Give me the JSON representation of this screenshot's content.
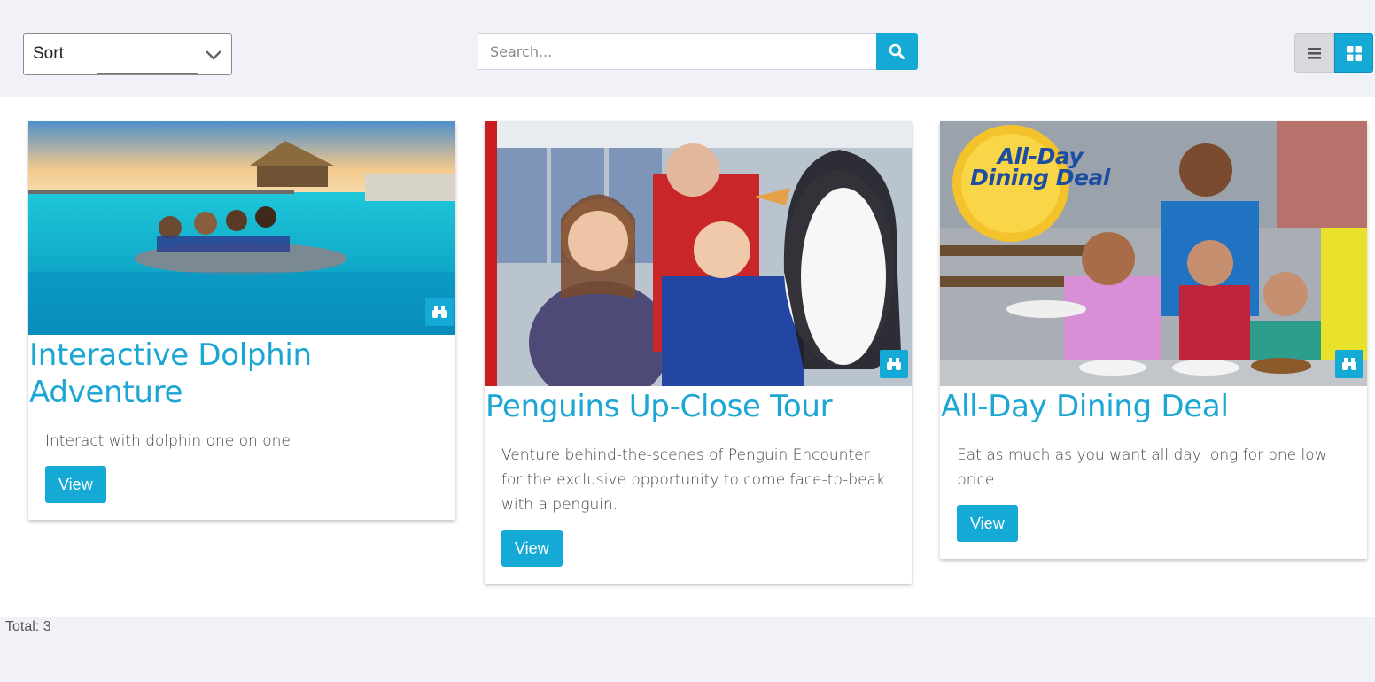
{
  "toolbar": {
    "sort_label": "Sort",
    "search_placeholder": "Search...",
    "search_value": ""
  },
  "colors": {
    "accent": "#15a9d6",
    "title": "#1ba6d3",
    "background": "#f1f2f7"
  },
  "icons": {
    "sort_chevron": "chevron-down-icon",
    "search": "search-icon",
    "list_view": "list-view-icon",
    "grid_view": "grid-view-icon",
    "details": "binoculars-icon"
  },
  "cards": [
    {
      "title": "Interactive Dolphin Adventure",
      "description": "Interact with dolphin one on one",
      "button": "View",
      "image": "dolphin swim photo"
    },
    {
      "title": "Penguins Up-Close Tour",
      "description": "Venture behind-the-scenes of Penguin Encounter for the exclusive opportunity to come face-to-beak with a penguin.",
      "button": "View",
      "image": "penguin encounter photo"
    },
    {
      "title": "All-Day Dining Deal",
      "description": "Eat as much as you want all day long for one low price.",
      "button": "View",
      "image": "family dining photo",
      "image_badge": "All-Day Dining Deal"
    }
  ],
  "footer": {
    "total": "Total: 3"
  }
}
